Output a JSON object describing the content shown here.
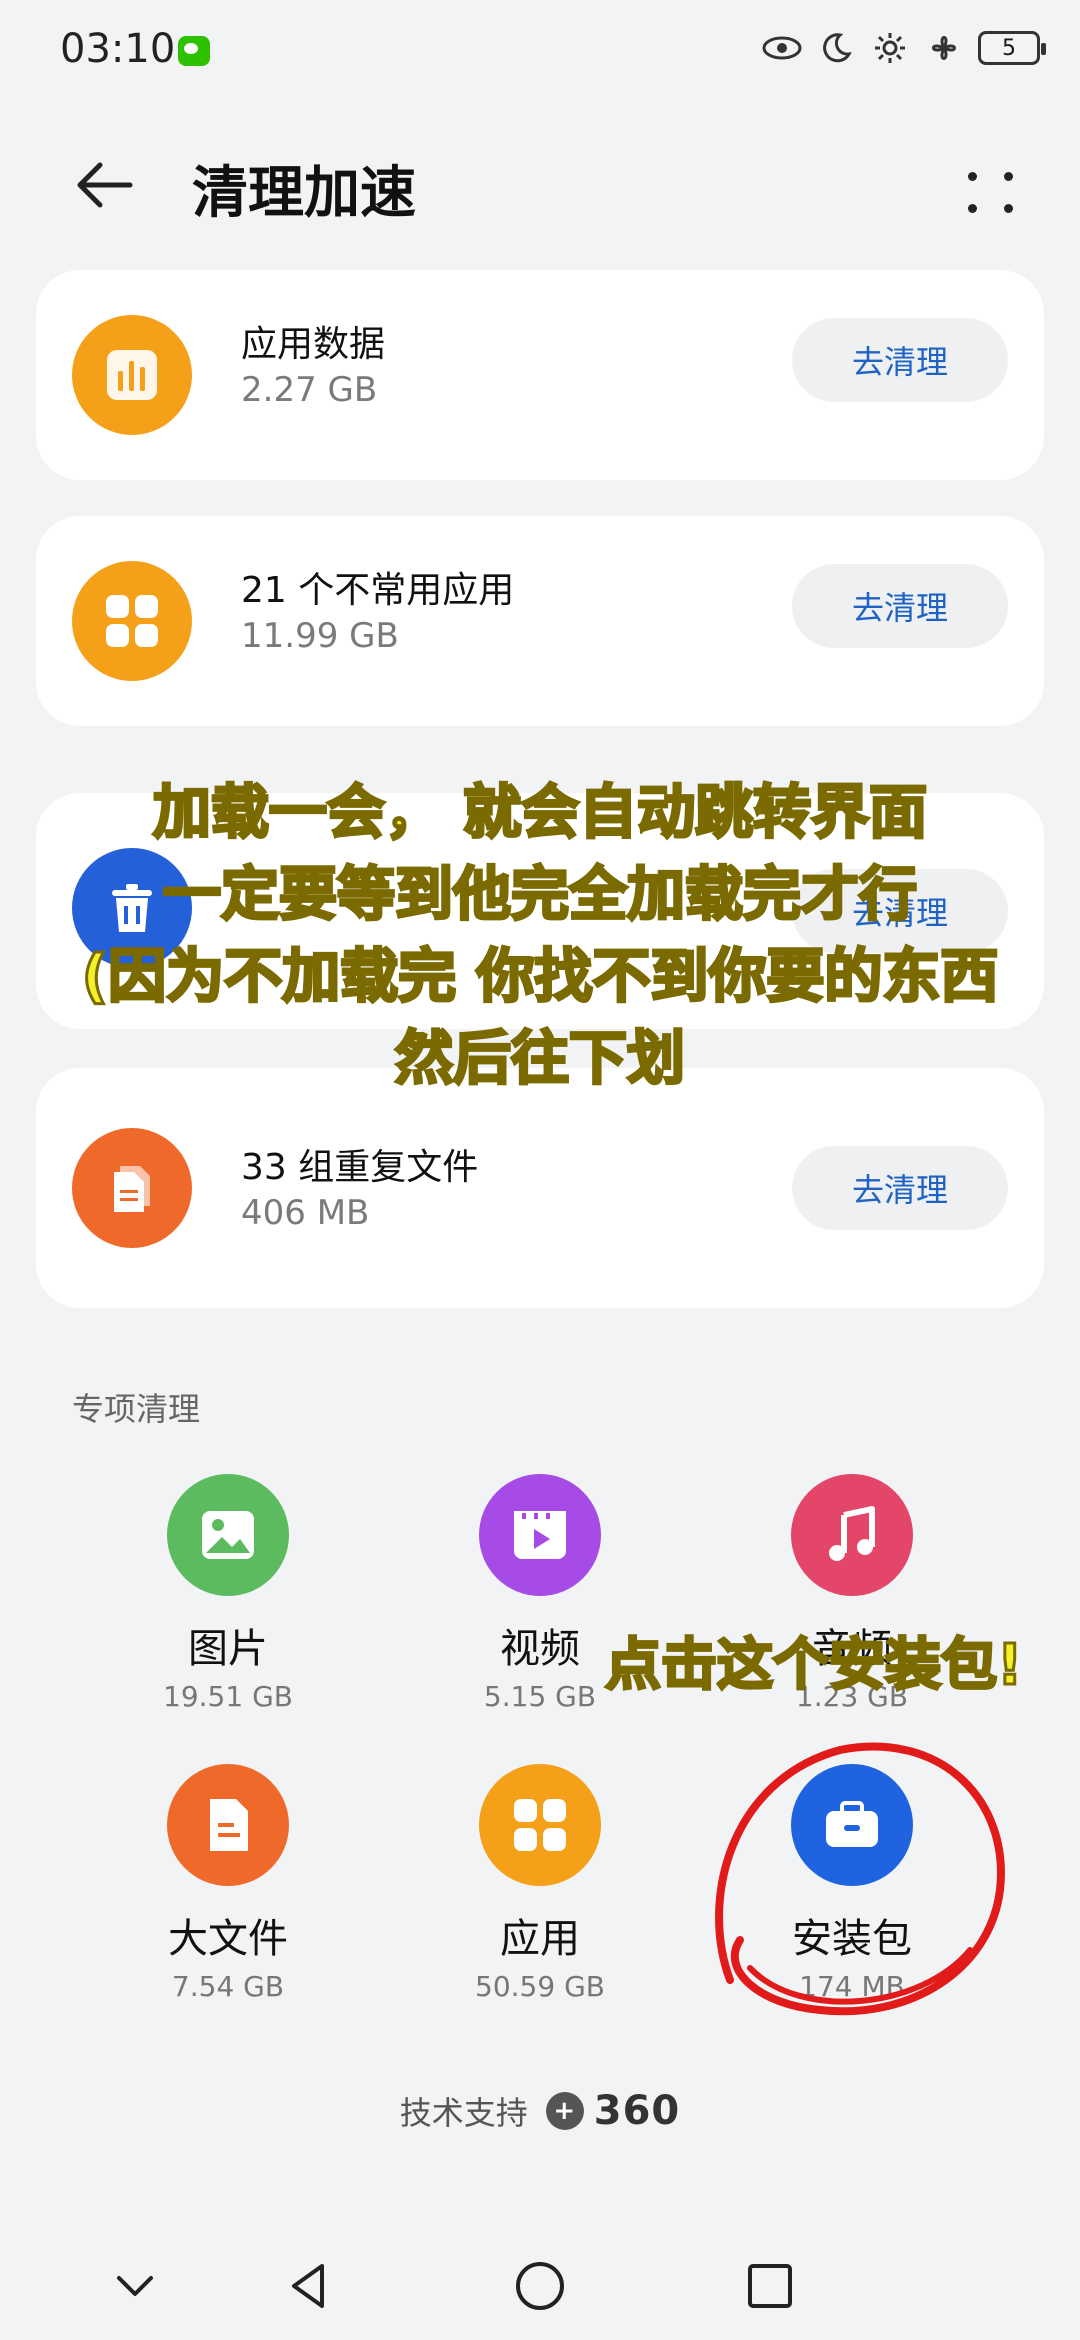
{
  "status_bar": {
    "time": "03:10",
    "battery": "5"
  },
  "header": {
    "title": "清理加速"
  },
  "cards": [
    {
      "title": "应用数据",
      "size": "2.27 GB",
      "button": "去清理",
      "icon": "bar-chart-icon",
      "color": "#f5a019"
    },
    {
      "title": "21 个不常用应用",
      "size": "11.99 GB",
      "button": "去清理",
      "icon": "apps-grid-icon",
      "color": "#f5a019"
    },
    {
      "title": "",
      "size": "",
      "button": "去清理",
      "icon": "trash-icon",
      "color": "#2460d8"
    },
    {
      "title": "33 组重复文件",
      "size": "406 MB",
      "button": "去清理",
      "icon": "duplicate-file-icon",
      "color": "#ef6a2a"
    }
  ],
  "section": {
    "title": "专项清理"
  },
  "items": [
    {
      "label": "图片",
      "size": "19.51 GB",
      "icon": "image-icon",
      "color": "#5bbb5e"
    },
    {
      "label": "视频",
      "size": "5.15 GB",
      "icon": "video-icon",
      "color": "#a64be6"
    },
    {
      "label": "音频",
      "size": "1.23 GB",
      "icon": "music-icon",
      "color": "#e34669"
    },
    {
      "label": "大文件",
      "size": "7.54 GB",
      "icon": "document-icon",
      "color": "#ef6a2a"
    },
    {
      "label": "应用",
      "size": "50.59 GB",
      "icon": "apps-grid-icon",
      "color": "#f5a019"
    },
    {
      "label": "安装包",
      "size": "174 MB",
      "icon": "toolbox-icon",
      "color": "#1f63e0"
    }
  ],
  "footer": {
    "text": "技术支持",
    "brand": "360"
  },
  "annotations": {
    "line1": "加载一会， 就会自动跳转界面",
    "line2": "一定要等到他完全加载完才行",
    "line3": "(因为不加载完 你找不到你要的东西",
    "line4": "然后往下划",
    "callout": "点击这个安装包!"
  }
}
